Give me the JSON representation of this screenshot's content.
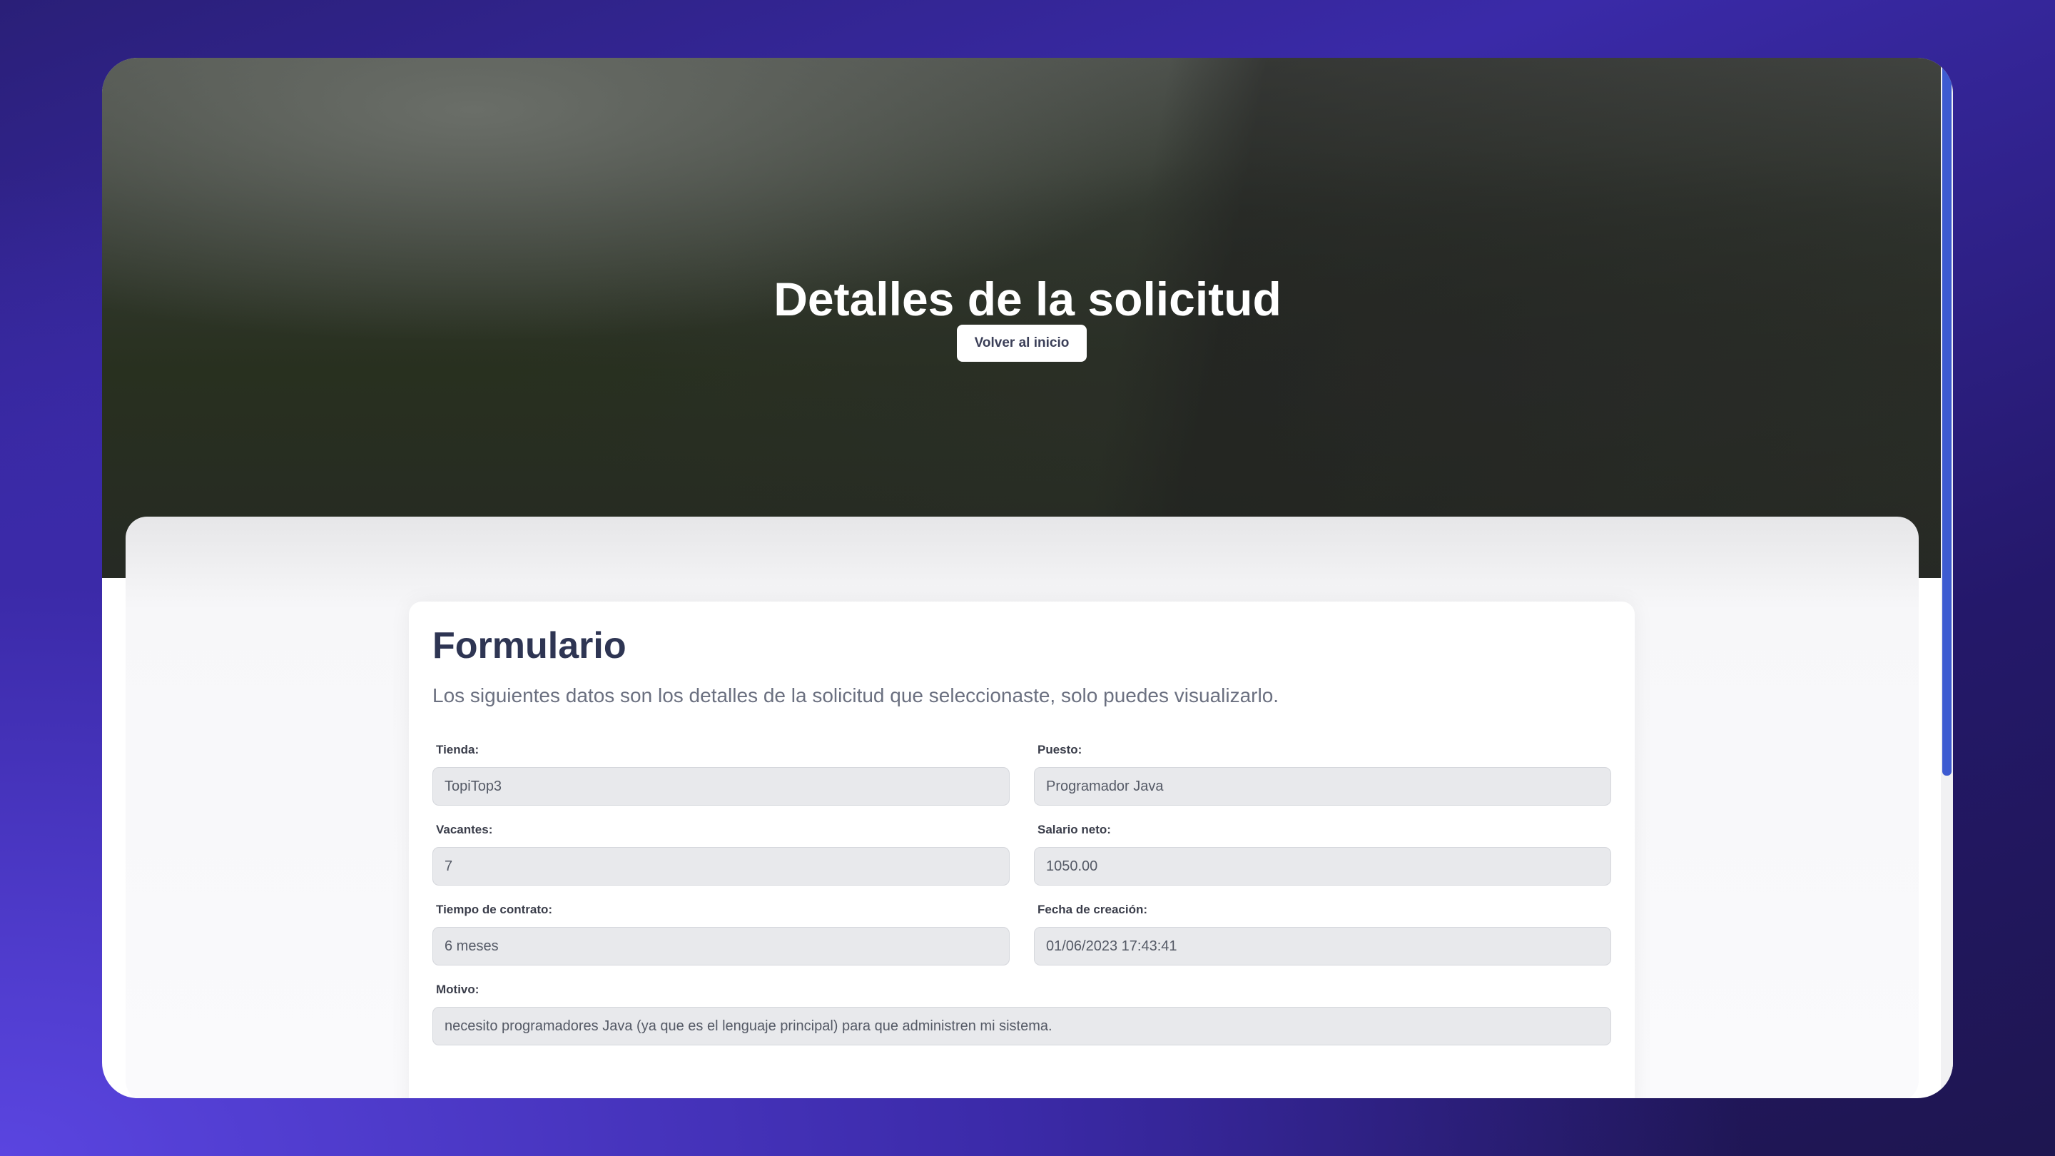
{
  "hero": {
    "title": "Detalles de la solicitud",
    "back_button": "Volver al inicio"
  },
  "form": {
    "title": "Formulario",
    "subtitle": "Los siguientes datos son los detalles de la solicitud que seleccionaste, solo puedes visualizarlo.",
    "fields": {
      "tienda": {
        "label": "Tienda:",
        "value": "TopiTop3"
      },
      "puesto": {
        "label": "Puesto:",
        "value": "Programador Java"
      },
      "vacantes": {
        "label": "Vacantes:",
        "value": "7"
      },
      "salario": {
        "label": "Salario neto:",
        "value": "1050.00"
      },
      "tiempo": {
        "label": "Tiempo de contrato:",
        "value": "6 meses"
      },
      "fecha": {
        "label": "Fecha de creación:",
        "value": "01/06/2023 17:43:41"
      },
      "motivo": {
        "label": "Motivo:",
        "value": "necesito programadores Java (ya que es el lenguaje principal) para que administren mi sistema."
      }
    }
  }
}
